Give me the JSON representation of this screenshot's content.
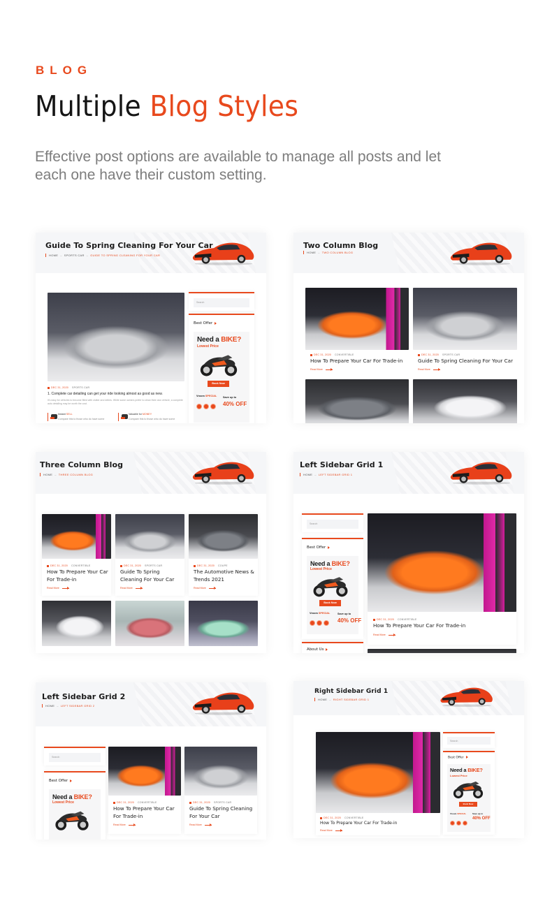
{
  "header": {
    "eyebrow": "BLOG",
    "title_plain": "Multiple",
    "title_accent": "Blog Styles",
    "description": "Effective post options are available to manage all posts and let each one have their custom setting."
  },
  "colors": {
    "accent": "#e8491d",
    "heading": "#151515",
    "body_text": "#7d7d7d"
  },
  "common": {
    "read_more": "Read More",
    "search_placeholder": "Search",
    "best_offer": "Best Offer",
    "about_us": "About Us",
    "ad": {
      "headline": "Need a",
      "headline_accent": "BIKE?",
      "subline": "Lowest Price",
      "button": "Book Now",
      "brand": "Vroom",
      "brand_accent": "SPECIAL",
      "save_label": "Save up to",
      "save_value": "40% OFF"
    }
  },
  "previews": [
    {
      "title": "Guide To Spring Cleaning For Your Car",
      "crumbs": [
        "HOME",
        "SPORTS CAR",
        "GUIDE TO SPRING CLEANING FOR YOUR CAR"
      ],
      "post": {
        "date": "DEC 31, 2020",
        "category": "SPORTS CAR",
        "lead": "1. Complete car detailing can get your ride looking almost as good as new.",
        "excerpt": "It's easy for vehicles to become filled with clutter and debris. While some owners prefer to clean their own vehicle, a complete auto detailing may be worth the cost.",
        "features": [
          {
            "label": "Instant",
            "accent": "SELL",
            "desc": "Compare this to those who do have some"
          },
          {
            "label": "Valuable for",
            "accent": "MONEY",
            "desc": "Compare this to those who do have some"
          }
        ]
      }
    },
    {
      "title": "Two Column Blog",
      "crumbs": [
        "HOME",
        "TWO COLUMN BLOG"
      ],
      "posts": [
        {
          "date": "DEC 31, 2020",
          "category": "CONVERTIBLE",
          "title": "How To Prepare Your Car For Trade-in"
        },
        {
          "date": "DEC 31, 2020",
          "category": "SPORTS CAR",
          "title": "Guide To Spring Cleaning For Your Car"
        }
      ]
    },
    {
      "title": "Three Column Blog",
      "crumbs": [
        "HOME",
        "THREE COLUMN BLOG"
      ],
      "posts": [
        {
          "date": "DEC 31, 2020",
          "category": "CONVERTIBLE",
          "title": "How To Prepare Your Car For Trade-in"
        },
        {
          "date": "DEC 31, 2020",
          "category": "SPORTS CAR",
          "title": "Guide To Spring Cleaning For Your Car"
        },
        {
          "date": "DEC 31, 2020",
          "category": "COUPE",
          "title": "The Automotive News & Trends 2021"
        }
      ]
    },
    {
      "title": "Left Sidebar Grid 1",
      "crumbs": [
        "HOME",
        "LEFT SIDEBAR GRID 1"
      ],
      "posts": [
        {
          "date": "DEC 31, 2020",
          "category": "CONVERTIBLE",
          "title": "How To Prepare Your Car For Trade-in"
        }
      ]
    },
    {
      "title": "Left Sidebar Grid 2",
      "crumbs": [
        "HOME",
        "LEFT SIDEBAR GRID 2"
      ],
      "posts": [
        {
          "date": "DEC 31, 2020",
          "category": "CONVERTIBLE",
          "title": "How To Prepare Your Car For Trade-in"
        },
        {
          "date": "DEC 31, 2020",
          "category": "SPORTS CAR",
          "title": "Guide To Spring Cleaning For Your Car"
        }
      ]
    },
    {
      "title": "Right Sidebar Grid 1",
      "crumbs": [
        "HOME",
        "RIGHT SIDEBAR GRID 1"
      ],
      "posts": [
        {
          "date": "DEC 31, 2020",
          "category": "CONVERTIBLE",
          "title": "How To Prepare Your Car For Trade-in"
        }
      ]
    }
  ]
}
